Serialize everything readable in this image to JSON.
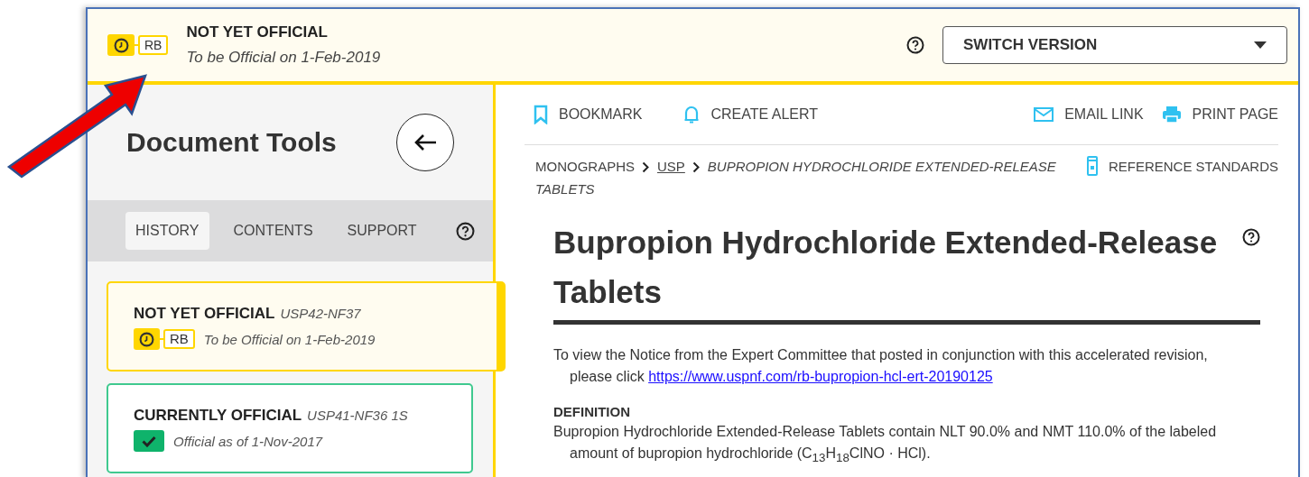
{
  "banner": {
    "status": "NOT YET OFFICIAL",
    "note": "To be Official on 1-Feb-2019",
    "badge": "RB",
    "kind": "pending",
    "switch_version": "SWITCH VERSION"
  },
  "sidebar": {
    "title": "Document Tools",
    "tabs": [
      {
        "label": "HISTORY",
        "selected": true
      },
      {
        "label": "CONTENTS",
        "selected": false
      },
      {
        "label": "SUPPORT",
        "selected": false
      }
    ],
    "versions": [
      {
        "kind": "pending",
        "status": "NOT YET OFFICIAL",
        "edition": "USP42-NF37",
        "badge": "RB",
        "note": "To be Official on 1-Feb-2019",
        "selected": true
      },
      {
        "kind": "official",
        "status": "CURRENTLY OFFICIAL",
        "edition": "USP41-NF36 1S",
        "note": "Official as of 1-Nov-2017",
        "selected": false
      }
    ]
  },
  "toolbar": {
    "left": [
      {
        "label": "BOOKMARK"
      },
      {
        "label": "CREATE ALERT"
      }
    ],
    "right": [
      {
        "label": "EMAIL LINK"
      },
      {
        "label": "PRINT PAGE"
      }
    ]
  },
  "breadcrumb": [
    {
      "kind": "link",
      "label": "MONOGRAPHS"
    },
    {
      "kind": "underlined",
      "label": "USP"
    },
    {
      "kind": "current",
      "lines": [
        "BUPROPION HYDROCHLORIDE EXTENDED-RELEASE",
        "TABLETS"
      ]
    }
  ],
  "reference_standards": "REFERENCE STANDARDS",
  "article": {
    "title": "Bupropion Hydrochloride Extended-Release Tablets",
    "notice": "To view the Notice from the Expert Committee that posted in conjunction with this accelerated revision, please click",
    "notice_link": "https://www.uspnf.com/rb-bupropion-hcl-ert-20190125",
    "section": "DEFINITION",
    "definition": "Bupropion Hydrochloride Extended-Release Tablets contain NLT 90.0% and NMT 110.0% of the labeled amount of bupropion hydrochloride (C$_{13}$H$_{18}$ClNO · HCl)."
  }
}
